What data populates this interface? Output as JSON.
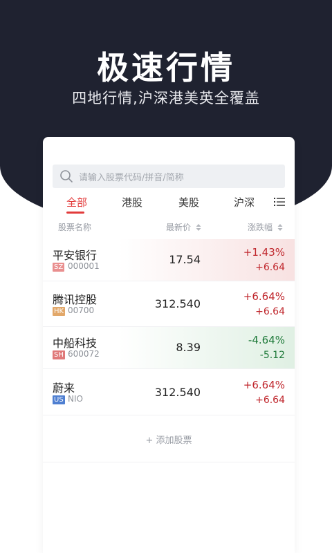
{
  "hero": {
    "title": "极速行情",
    "subtitle": "四地行情,沪深港美英全覆盖"
  },
  "search": {
    "placeholder": "请输入股票代码/拼音/简称",
    "icon": "search-icon"
  },
  "tabs": [
    {
      "label": "全部",
      "active": true
    },
    {
      "label": "港股",
      "active": false
    },
    {
      "label": "美股",
      "active": false
    },
    {
      "label": "沪深",
      "active": false
    }
  ],
  "menu_icon": "list-menu-icon",
  "columns": {
    "name": "股票名称",
    "price": "最新价",
    "change": "涨跌幅"
  },
  "stocks": [
    {
      "name": "平安银行",
      "market": "SZ",
      "code": "000001",
      "price": "17.54",
      "pct": "+1.43%",
      "chg": "+6.64",
      "trend": "up"
    },
    {
      "name": "腾讯控股",
      "market": "HK",
      "code": "00700",
      "price": "312.540",
      "pct": "+6.64%",
      "chg": "+6.64",
      "trend": "up"
    },
    {
      "name": "中船科技",
      "market": "SH",
      "code": "600072",
      "price": "8.39",
      "pct": "-4.64%",
      "chg": "-5.12",
      "trend": "down"
    },
    {
      "name": "蔚来",
      "market": "US",
      "code": "NIO",
      "price": "312.540",
      "pct": "+6.64%",
      "chg": "+6.64",
      "trend": "up"
    }
  ],
  "market_tag_colors": {
    "SZ": "#e98f8f",
    "HK": "#e2a86a",
    "SH": "#e07a7a",
    "US": "#4f7fd1"
  },
  "add_stock": "+ 添加股票",
  "colors": {
    "accent": "#e23b3b",
    "up": "#c0272d",
    "down": "#1f7a3a",
    "hero_bg": "#1f2230"
  }
}
